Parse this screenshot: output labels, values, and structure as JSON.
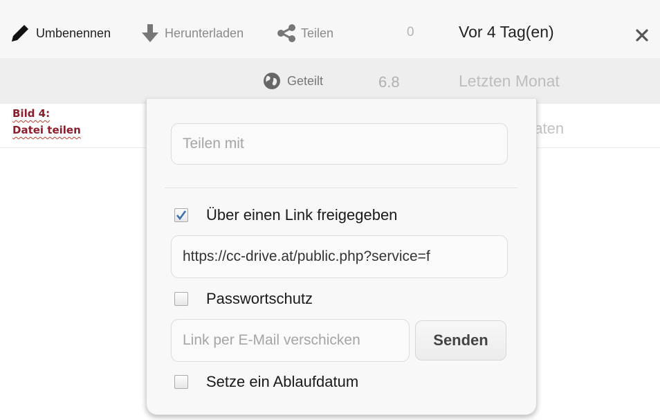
{
  "actions": {
    "rename": "Umbenennen",
    "download": "Herunterladen",
    "share": "Teilen"
  },
  "rows": [
    {
      "size": "0",
      "date": "Vor 4 Tag(en)"
    },
    {
      "shared_label": "Geteilt",
      "size": "6.8",
      "date": "Letzten Monat"
    },
    {
      "date_fragment": "naten"
    }
  ],
  "caption": {
    "line1": "Bild 4:",
    "line2": "Datei teilen"
  },
  "share_dialog": {
    "share_with_placeholder": "Teilen mit",
    "link_checkbox": {
      "label": "Über einen Link freigegeben",
      "checked": true
    },
    "link_url": "https://cc-drive.at/public.php?service=f",
    "password_checkbox": {
      "label": "Passwortschutz",
      "checked": false
    },
    "email_placeholder": "Link per E-Mail verschicken",
    "send_label": "Senden",
    "expiry_checkbox": {
      "label": "Setze ein Ablaufdatum",
      "checked": false
    }
  },
  "icons": {
    "rename": "pencil-icon",
    "download": "download-arrow-icon",
    "share": "share-icon",
    "shared": "globe-icon",
    "close": "close-icon",
    "check": "checkmark-icon"
  },
  "colors": {
    "caption": "#8b1d2c",
    "checkmark": "#3b6fb0",
    "row_header_bg": "#f7f7f7",
    "row_selected_bg": "#eeeeee"
  }
}
